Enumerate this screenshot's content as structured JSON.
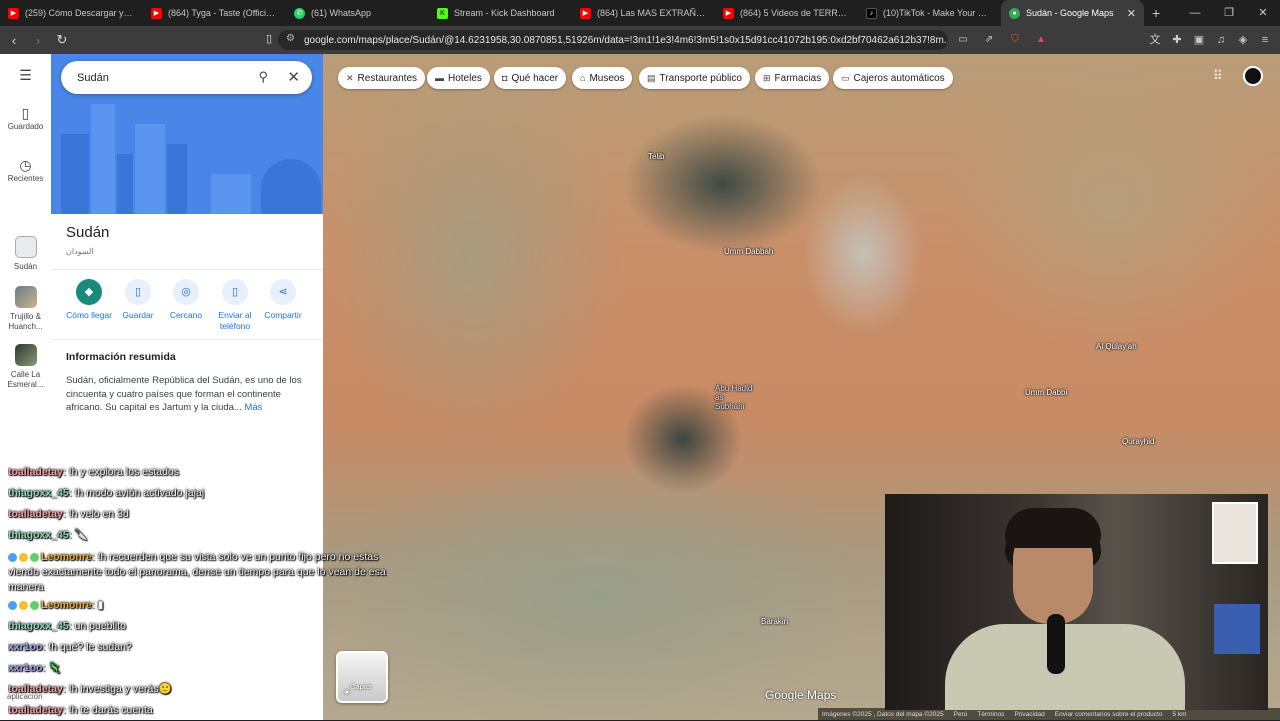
{
  "tabs": [
    {
      "label": "(259) Cómo Descargar y Config",
      "icon": "youtube-icon",
      "color": "#ff0000"
    },
    {
      "label": "(864) Tyga - Taste (Official Vide",
      "icon": "youtube-icon",
      "color": "#ff0000"
    },
    {
      "label": "(61) WhatsApp",
      "icon": "whatsapp-icon",
      "color": "#25d366"
    },
    {
      "label": "Stream - Kick Dashboard",
      "icon": "kick-icon",
      "color": "#53fc18"
    },
    {
      "label": "(864) Las MAS EXTRAÑAS CIN",
      "icon": "youtube-icon",
      "color": "#ff0000"
    },
    {
      "label": "(864) 5 Videos de TERROR EXT",
      "icon": "youtube-icon",
      "color": "#ff0000"
    },
    {
      "label": "(10)TikTok - Make Your Day",
      "icon": "tiktok-icon",
      "color": "#000000"
    },
    {
      "label": "Sudán - Google Maps",
      "icon": "maps-icon",
      "color": "#34a853"
    }
  ],
  "address": {
    "url": "google.com/maps/place/Sudán/@14.6231958,30.0870851,51926m/data=!3m1!1e3!4m6!3m5!1s0x15d91cc41072b195:0xd2bf70462a612b37!8m..."
  },
  "sidebar_rail": {
    "saved": "Guardado",
    "recent": "Recientes",
    "sudan": "Sudán",
    "trujillo": "Trujillo & Huanch...",
    "calle": "Calle La Esmeral..."
  },
  "search": {
    "value": "Sudán"
  },
  "place": {
    "title": "Sudán",
    "subtitle": "السودان",
    "actions": [
      {
        "label": "Cómo llegar",
        "icon": "directions-icon"
      },
      {
        "label": "Guardar",
        "icon": "bookmark-icon"
      },
      {
        "label": "Cercano",
        "icon": "nearby-icon"
      },
      {
        "label": "Enviar al teléfono",
        "icon": "phone-icon"
      },
      {
        "label": "Compartir",
        "icon": "share-icon"
      }
    ],
    "about_heading": "Información resumida",
    "about_text": "Sudán, oficialmente República del Sudán, es uno de los cincuenta y cuatro países que forman el continente africano. Su capital es Jartum y la ciuda...",
    "more": "Más"
  },
  "chips": [
    {
      "label": "Restaurantes",
      "icon": "fork-icon"
    },
    {
      "label": "Hoteles",
      "icon": "bed-icon"
    },
    {
      "label": "Qué hacer",
      "icon": "camera-icon"
    },
    {
      "label": "Museos",
      "icon": "museum-icon"
    },
    {
      "label": "Transporte público",
      "icon": "train-icon"
    },
    {
      "label": "Farmacias",
      "icon": "pharmacy-icon"
    },
    {
      "label": "Cajeros automáticos",
      "icon": "atm-icon"
    }
  ],
  "map_labels": [
    "Telib",
    "Umm Dabbah",
    "Al Qulay'ah",
    "Umm Dabbi",
    "Abu Hadid as Subhani",
    "Qurayhid",
    "Barakin"
  ],
  "layers_label": "Capas",
  "logo": "Google Maps",
  "footer": [
    "Imágenes ©2025 , Datos del mapa ©2025",
    "Perú",
    "Términos",
    "Privacidad",
    "Enviar comentarios sobre el producto",
    "5 km"
  ],
  "chat": [
    {
      "user": "toalladetay",
      "msg": "!h y explora los estados",
      "color": "#f0a0a0"
    },
    {
      "user": "thiagoxx_45",
      "msg": "!h modo avión activado jajaj",
      "color": "#8fd8b8"
    },
    {
      "user": "toalladetay",
      "msg": "!h velo en 3d",
      "color": "#f0a0a0"
    },
    {
      "user": "thiagoxx_45",
      "msg": "🔪",
      "color": "#8fd8b8"
    },
    {
      "user": "Leomonre",
      "msg": "!h recuerden que su vista solo ve un punto fijo pero no estas viendo exactamente todo el panorama, dense un tiempo para que lo vean de esa manera",
      "color": "#f0b030"
    },
    {
      "user": "Leomonre",
      "msg": "▮",
      "color": "#f0b030"
    },
    {
      "user": "thiagoxx_45",
      "msg": "un pueblito",
      "color": "#8fd8b8"
    },
    {
      "user": "xxr1oo",
      "msg": "!h qué? le sudan?",
      "color": "#a0a8f0"
    },
    {
      "user": "xxr1oo",
      "msg": "🦎",
      "color": "#a0a8f0"
    },
    {
      "user": "toalladetay",
      "msg": "!h investiga y verás🙂",
      "color": "#f0a0a0"
    },
    {
      "user": "toalladetay",
      "msg": "!h te darás cuenta",
      "color": "#f0a0a0"
    }
  ],
  "taskbar_hint": "aplicación"
}
